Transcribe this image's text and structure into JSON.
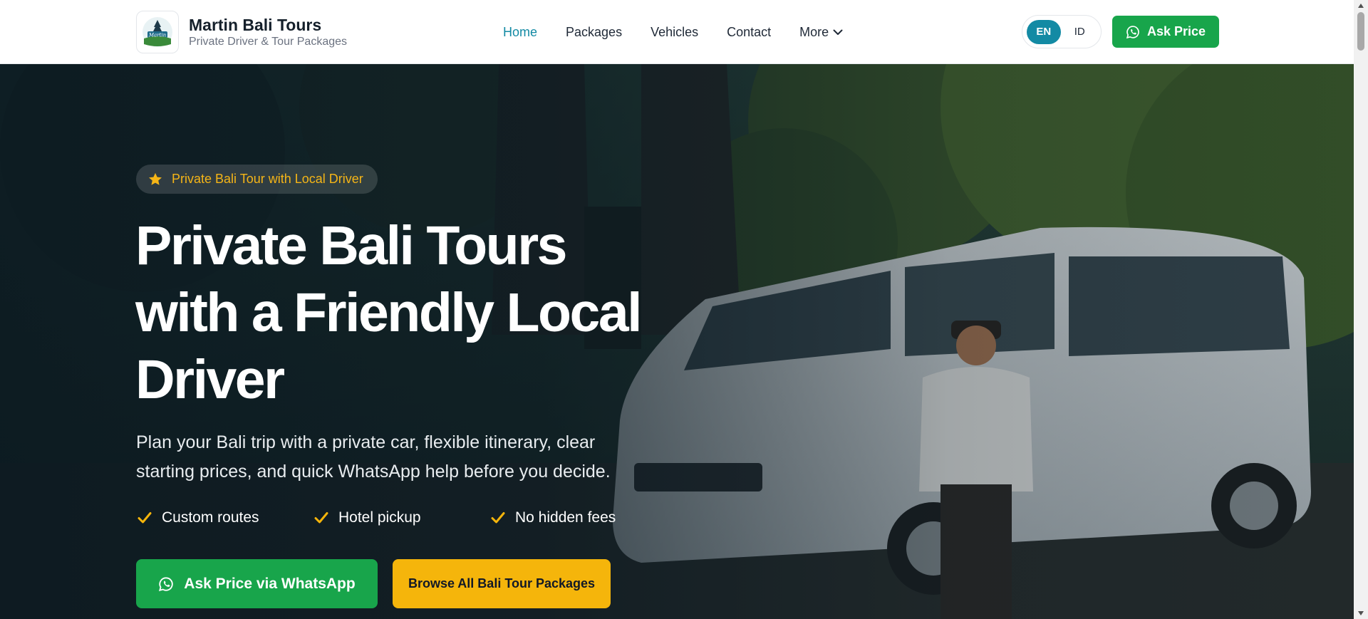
{
  "brand": {
    "name": "Martin Bali Tours",
    "tagline": "Private Driver & Tour Packages",
    "logo_text": "Martin"
  },
  "nav": {
    "items": [
      {
        "label": "Home",
        "active": true
      },
      {
        "label": "Packages",
        "active": false
      },
      {
        "label": "Vehicles",
        "active": false
      },
      {
        "label": "Contact",
        "active": false
      }
    ],
    "more_label": "More"
  },
  "lang": {
    "options": [
      "EN",
      "ID"
    ],
    "selected": "EN"
  },
  "header_cta": {
    "label": "Ask Price",
    "icon": "whatsapp-icon"
  },
  "hero": {
    "badge": "Private Bali Tour with Local Driver",
    "title_lines": [
      "Private Bali Tours",
      "with a Friendly Local",
      "Driver"
    ],
    "description_lines": [
      "Plan your Bali trip with a private car, flexible itinerary, clear",
      "starting prices, and quick WhatsApp help before you decide."
    ],
    "features": [
      "Custom routes",
      "Hotel pickup",
      "No hidden fees"
    ],
    "cta_primary": "Ask Price via WhatsApp",
    "cta_secondary": "Browse All Bali Tour Packages"
  },
  "colors": {
    "accent": "#138aa4",
    "whatsapp_green": "#18a54b",
    "yellow": "#f5b50b"
  }
}
